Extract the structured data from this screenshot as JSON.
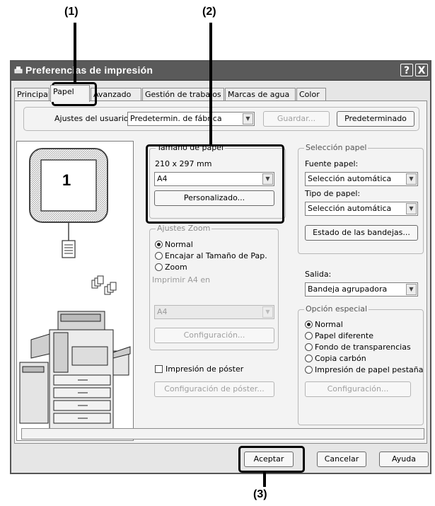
{
  "callouts": {
    "c1": "(1)",
    "c2": "(2)",
    "c3": "(3)"
  },
  "window": {
    "title": "Preferencias de impresión",
    "help_btn": "?",
    "close_btn": "X"
  },
  "tabs": [
    {
      "label": "Principal"
    },
    {
      "label": "Papel"
    },
    {
      "label": "Avanzado"
    },
    {
      "label": "Gestión de trabajos"
    },
    {
      "label": "Marcas de agua"
    },
    {
      "label": "Color"
    }
  ],
  "user_settings": {
    "label": "Ajustes del usuario:",
    "value": "Predetermin. de fábrica",
    "save_btn": "Guardar...",
    "default_btn": "Predeterminado"
  },
  "preview": {
    "page_number": "1"
  },
  "paper_size": {
    "title": "Tamaño de papel",
    "dimensions": "210 x 297 mm",
    "value": "A4",
    "custom_btn": "Personalizado..."
  },
  "zoom": {
    "title": "Ajustes Zoom",
    "options": [
      "Normal",
      "Encajar al Tamaño de Pap.",
      "Zoom"
    ],
    "selected": 0,
    "print_on_label": "Imprimir A4 en",
    "print_on_value": "A4",
    "config_btn": "Configuración..."
  },
  "poster": {
    "label": "Impresión de póster",
    "checked": false,
    "config_btn": "Configuración de póster..."
  },
  "paper_selection": {
    "title": "Selección papel",
    "source_label": "Fuente papel:",
    "source_value": "Selección automática",
    "type_label": "Tipo de papel:",
    "type_value": "Selección automática",
    "tray_status_btn": "Estado de las bandejas..."
  },
  "output": {
    "label": "Salida:",
    "value": "Bandeja agrupadora"
  },
  "special": {
    "title": "Opción especial",
    "options": [
      "Normal",
      "Papel diferente",
      "Fondo de transparencias",
      "Copia carbón",
      "Impresión de papel pestaña"
    ],
    "selected": 0,
    "config_btn": "Configuración..."
  },
  "footer": {
    "ok_btn": "Aceptar",
    "cancel_btn": "Cancelar",
    "help_btn": "Ayuda"
  }
}
